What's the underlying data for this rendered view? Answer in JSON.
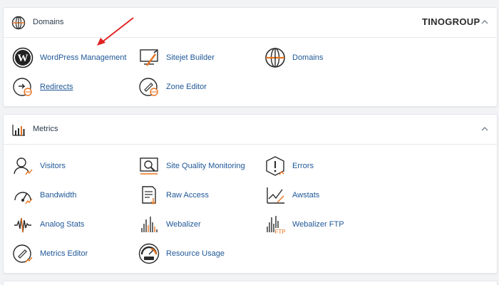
{
  "brand": {
    "part1": "TINO",
    "part2": "GROUP"
  },
  "domains_panel": {
    "title": "Domains",
    "items": [
      {
        "label": "WordPress Management",
        "icon": "wordpress-icon"
      },
      {
        "label": "Sitejet Builder",
        "icon": "sitejet-builder-icon"
      },
      {
        "label": "Domains",
        "icon": "globe-icon"
      },
      {
        "label": "Redirects",
        "icon": "redirects-icon"
      },
      {
        "label": "Zone Editor",
        "icon": "zone-editor-icon"
      }
    ]
  },
  "metrics_panel": {
    "title": "Metrics",
    "items": [
      {
        "label": "Visitors",
        "icon": "visitors-icon"
      },
      {
        "label": "Site Quality Monitoring",
        "icon": "site-quality-icon"
      },
      {
        "label": "Errors",
        "icon": "errors-icon"
      },
      {
        "label": "Bandwidth",
        "icon": "bandwidth-icon"
      },
      {
        "label": "Raw Access",
        "icon": "raw-access-icon"
      },
      {
        "label": "Awstats",
        "icon": "awstats-icon"
      },
      {
        "label": "Analog Stats",
        "icon": "analog-stats-icon"
      },
      {
        "label": "Webalizer",
        "icon": "webalizer-icon"
      },
      {
        "label": "Webalizer FTP",
        "icon": "webalizer-ftp-icon"
      },
      {
        "label": "Metrics Editor",
        "icon": "metrics-editor-icon"
      },
      {
        "label": "Resource Usage",
        "icon": "resource-usage-icon"
      }
    ]
  },
  "colors": {
    "link": "#1f5797",
    "accent_orange": "#e8731f",
    "annotation_arrow": "#e02424"
  }
}
